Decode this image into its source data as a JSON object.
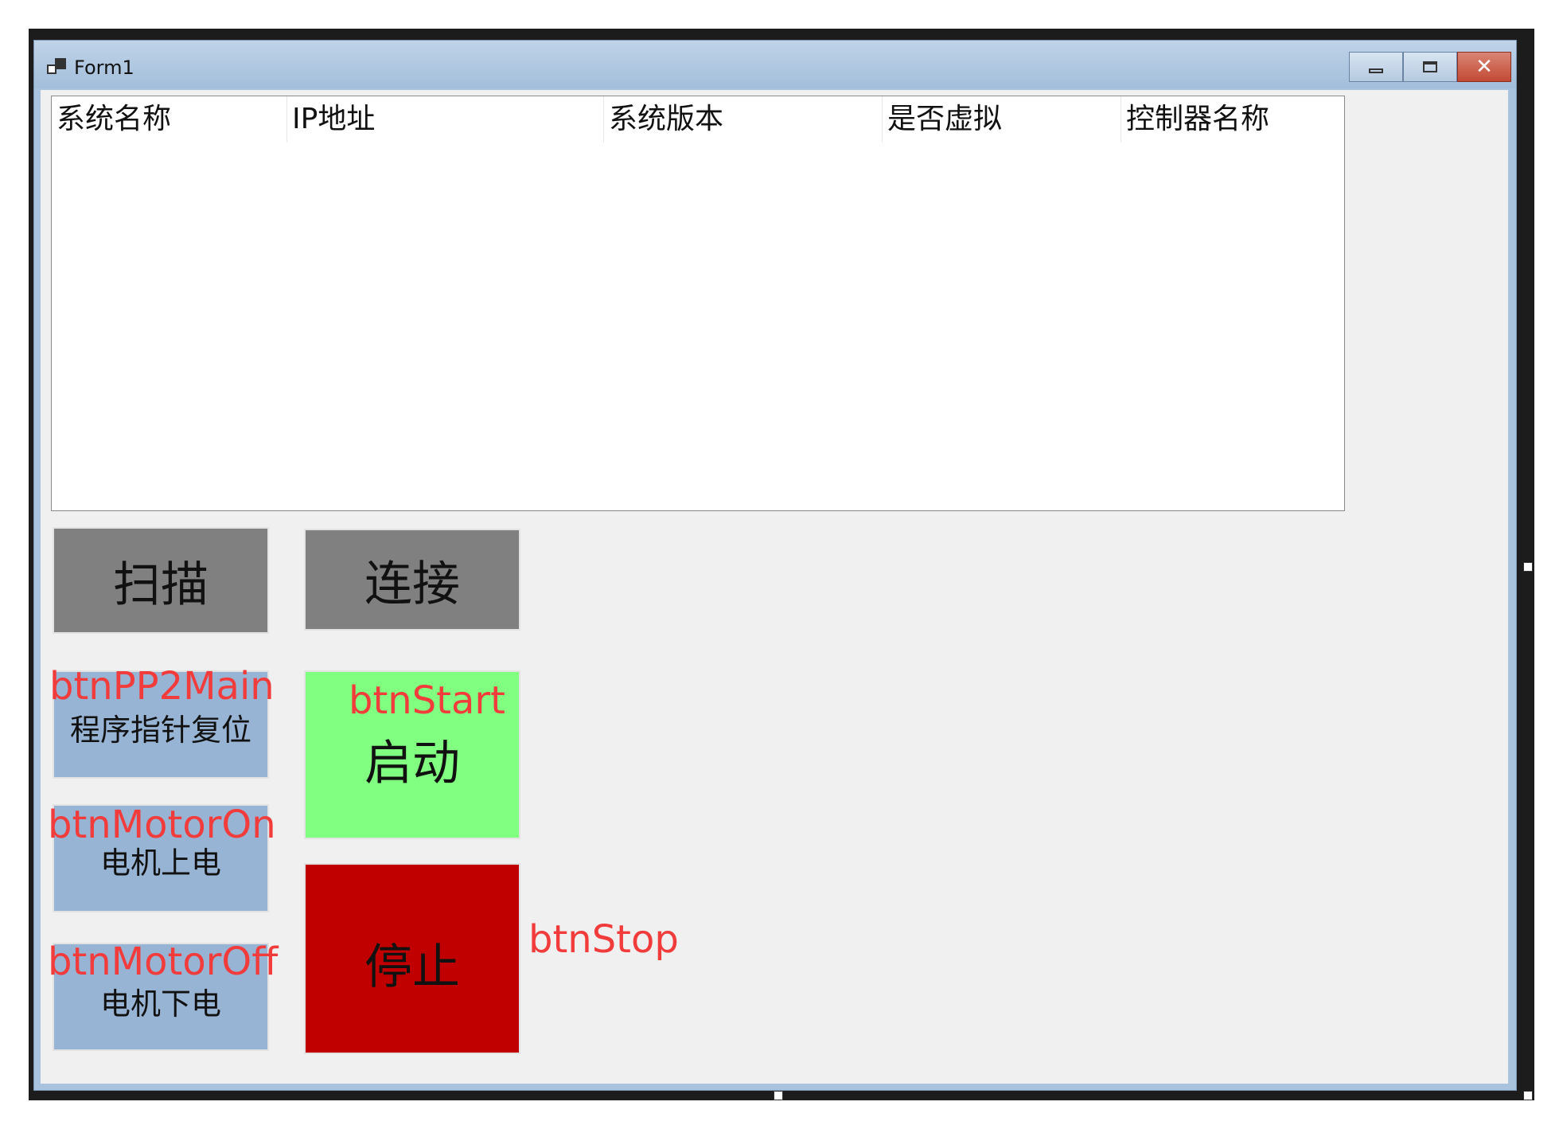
{
  "window": {
    "title": "Form1"
  },
  "listview": {
    "columns": [
      "系统名称",
      "IP地址",
      "系统版本",
      "是否虚拟",
      "控制器名称"
    ]
  },
  "buttons": {
    "scan": "扫描",
    "connect": "连接",
    "pp2main": "程序指针复位",
    "motor_on": "电机上电",
    "motor_off": "电机下电",
    "start": "启动",
    "stop": "停止"
  },
  "annotations": {
    "pp2main": "btnPP2Main",
    "motor_on": "btnMotorOn",
    "motor_off": "btnMotorOff",
    "start": "btnStart",
    "stop": "btnStop"
  }
}
